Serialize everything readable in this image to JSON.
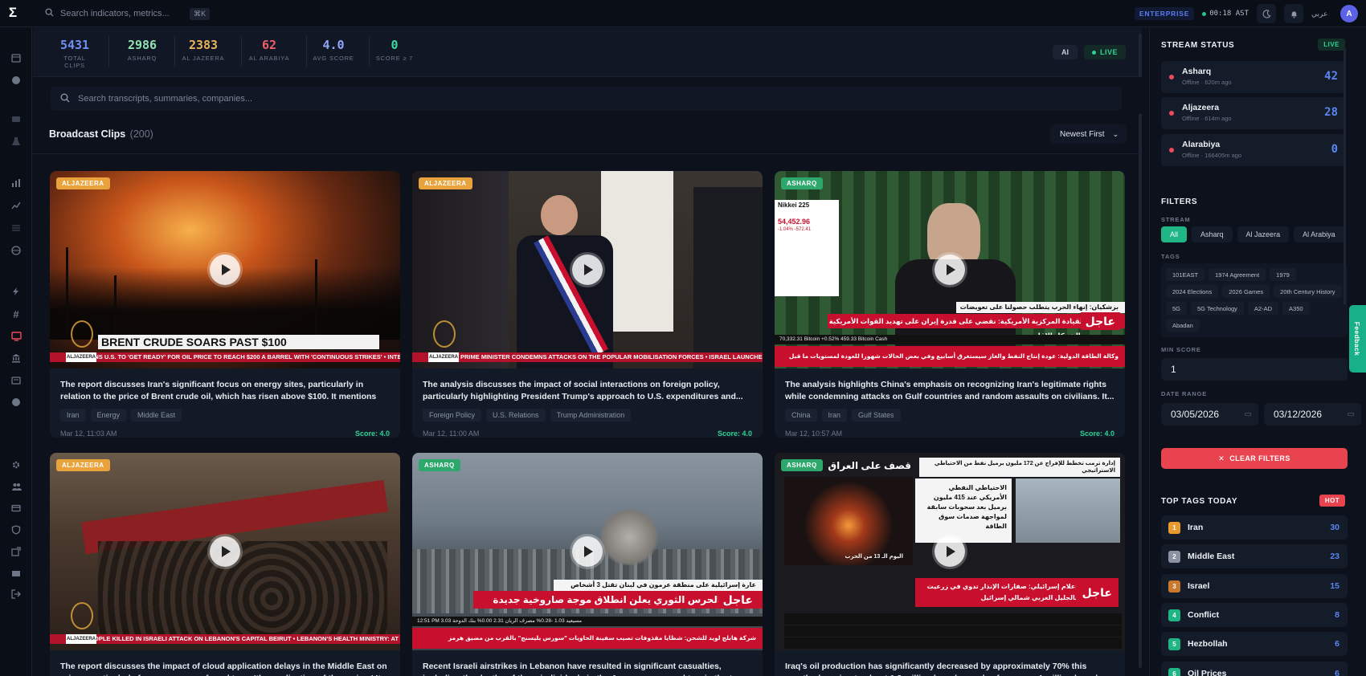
{
  "topbar": {
    "search_placeholder": "Search indicators, metrics...",
    "shortcut": "⌘K",
    "plan": "ENTERPRISE",
    "clock": "00:18 AST",
    "language": "عربي",
    "avatar": "A"
  },
  "stats": [
    {
      "value": "5431",
      "label": "TOTAL CLIPS",
      "color": "#6f8ff2"
    },
    {
      "value": "2986",
      "label": "ASHARQ",
      "color": "#8fe3b0"
    },
    {
      "value": "2383",
      "label": "AL JAZEERA",
      "color": "#e8b35a"
    },
    {
      "value": "62",
      "label": "AL ARABIYA",
      "color": "#ef5e6b"
    },
    {
      "value": "4.0",
      "label": "AVG SCORE",
      "color": "#93a7f7"
    },
    {
      "value": "0",
      "label": "SCORE ≥ 7",
      "color": "#3fd8a1"
    }
  ],
  "mode": {
    "ai": "AI",
    "live": "LIVE"
  },
  "search": {
    "placeholder": "Search transcripts, summaries, companies..."
  },
  "section": {
    "title": "Broadcast Clips",
    "count": "(200)",
    "sort": "Newest First"
  },
  "clips": [
    {
      "source": "ALJAZEERA",
      "headline": "BRENT CRUDE SOARS PAST $100",
      "ticker": "RNS U.S. TO 'GET READY' FOR OIL PRICE TO REACH $200 A BARREL WITH 'CONTINUOUS STRIKES' • INTER",
      "summary": "The report discusses Iran's significant focus on energy sites, particularly in relation to the price of Brent crude oil, which has risen above $100. It mentions threats to...",
      "tags": [
        "Iran",
        "Energy",
        "Middle East"
      ],
      "date": "Mar 12, 11:03 AM",
      "score": "Score: 4.0"
    },
    {
      "source": "ALJAZEERA",
      "ticker": "QI PRIME MINISTER CONDEMNS ATTACKS ON THE POPULAR MOBILISATION FORCES • ISRAEL LAUNCHES A",
      "summary": "The analysis discusses the impact of social interactions on foreign policy, particularly highlighting President Trump's approach to U.S. expenditures and...",
      "tags": [
        "Foreign Policy",
        "U.S. Relations",
        "Trump Administration"
      ],
      "date": "Mar 12, 11:00 AM",
      "score": "Score: 4.0"
    },
    {
      "source": "ASHARQ",
      "overlay_top": "Nikkei 225",
      "overlay_value": "54,452.96",
      "overlay_change": "-1.04%  -572.41",
      "urgent": "عاجل",
      "arabic_top": "بزشكيان: إنهاء الحرب يتطلب حصولنا على تعويضات",
      "arabic_main": "القيادة المركزية الأمريكية: نقضي على قدرة إيران على تهديد القوات الأمريكية والشركاء الإقليميين",
      "arabic_bottom": "وكالة الطاقة الدولية: عودة إنتاج النفط والغاز سيستغرق أسابيع وفي بعض الحالات شهورا للعودة لمستويات ما قبل الأزمة",
      "market": "70,332.31  Bitcoin   +0.52%   459.33  Bitcoin Cash",
      "summary": "The analysis highlights China's emphasis on recognizing Iran's legitimate rights while condemning attacks on Gulf countries and random assaults on civilians. It...",
      "tags": [
        "China",
        "Iran",
        "Gulf States"
      ],
      "date": "Mar 12, 10:57 AM",
      "score": "Score: 4.0"
    },
    {
      "source": "ALJAZEERA",
      "ticker": "EOPLE KILLED IN ISRAELI ATTACK ON LEBANON'S CAPITAL BEIRUT • LEBANON'S HEALTH MINISTRY: AT",
      "summary": "The report discusses the impact of cloud application delays in the Middle East on prices, particularly for a company referred to as 'the application of the region.' It..."
    },
    {
      "source": "ASHARQ",
      "urgent": "عاجل",
      "arabic_top": "غارة إسرائيلية على منطقة عرمون في لبنان تقتل 3 أشخاص",
      "arabic_main": "الحرس الثوري يعلن انطلاق موجة صاروخية جديدة",
      "arabic_bottom": "شركة هابلج لويد للشحن: شظايا مقذوفات تصيب سفينة الحاويات \"سورس بليسنج\" بالقرب من مضيق هرمز",
      "market": "12:51 PM   مسيعيد 1.03   -0.28%   مصرف الريان 2.31   0.00%   بنك الدوحة 3.03",
      "summary": "Recent Israeli airstrikes in Lebanon have resulted in significant casualties, including the deaths of three individuals in the Aramoun area and two in the town of Deir..."
    },
    {
      "source": "ASHARQ",
      "banner": "قصف على العراق",
      "urgent": "عاجل",
      "arabic_top": "إدارة ترمب تخطط للإفراج عن 172 مليون برميل نفط من الاحتياطي الاستراتيجي",
      "arabic_panel": "الاحتياطي النفطي الأمريكي عند 415 مليون برميل بعد سحوبات سابقة لمواجهة صدمات سوق الطاقة",
      "arabic_main": "إعلام إسرائيلي: صفارات الإنذار تدوي في زرعيت بالجليل الغربي شمالي إسرائيل",
      "day": "اليوم الـ 13 من الحرب",
      "summary": "Iraq's oil production has significantly decreased by approximately 70% this month, dropping to about 1.2 million barrels per day from over 4 million barrels previously..."
    }
  ],
  "panel": {
    "stream_title": "STREAM STATUS",
    "live": "LIVE",
    "streams": [
      {
        "name": "Asharq",
        "status": "Offline · 620m ago",
        "count": "42"
      },
      {
        "name": "Aljazeera",
        "status": "Offline · 614m ago",
        "count": "28"
      },
      {
        "name": "Alarabiya",
        "status": "Offline · 166405m ago",
        "count": "0"
      }
    ],
    "filters_title": "FILTERS",
    "stream_label": "STREAM",
    "stream_chips": [
      "All",
      "Asharq",
      "Al Jazeera",
      "Al Arabiya"
    ],
    "tags_label": "TAGS",
    "tag_chips": [
      "101EAST",
      "1974 Agreement",
      "1979",
      "2024 Elections",
      "2026 Games",
      "20th Century History",
      "5G",
      "5G Technology",
      "A2-AD",
      "A350",
      "Abadan"
    ],
    "min_score_label": "MIN SCORE",
    "min_score": "1",
    "date_label": "DATE RANGE",
    "date_from": "03/05/2026",
    "date_to": "03/12/2026",
    "clear": "CLEAR FILTERS",
    "top_tags_title": "TOP TAGS TODAY",
    "hot": "HOT",
    "top_tags": [
      {
        "rank": "1",
        "name": "Iran",
        "count": "30",
        "color": "#e89a2f"
      },
      {
        "rank": "2",
        "name": "Middle East",
        "count": "23",
        "color": "#8b93a3"
      },
      {
        "rank": "3",
        "name": "Israel",
        "count": "15",
        "color": "#c9782e"
      },
      {
        "rank": "4",
        "name": "Conflict",
        "count": "8",
        "color": "#1fb585"
      },
      {
        "rank": "5",
        "name": "Hezbollah",
        "count": "6",
        "color": "#1fb585"
      },
      {
        "rank": "6",
        "name": "Oil Prices",
        "count": "6",
        "color": "#1fb585"
      }
    ],
    "feedback": "Feedback"
  }
}
